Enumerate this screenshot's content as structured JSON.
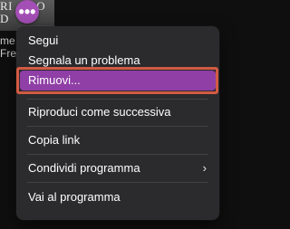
{
  "background": {
    "title": "RI       O\nD",
    "subtitle": "me\nFre"
  },
  "more_button": {
    "icon": "more-dots-icon",
    "glyph": "•••",
    "color": "#a34fb5"
  },
  "menu": {
    "items": [
      {
        "label": "Segui"
      },
      {
        "label": "Segnala un problema"
      },
      {
        "label": "Rimuovi...",
        "highlighted": true
      },
      {
        "label": "Riproduci come successiva"
      },
      {
        "label": "Copia link"
      },
      {
        "label": "Condividi programma",
        "submenu_icon": "chevron-right-icon",
        "glyph": "›"
      },
      {
        "label": "Vai al programma"
      }
    ],
    "colors": {
      "background": "#2b2b2d",
      "highlight": "#8f3fa6",
      "outline": "#d25a43"
    }
  }
}
